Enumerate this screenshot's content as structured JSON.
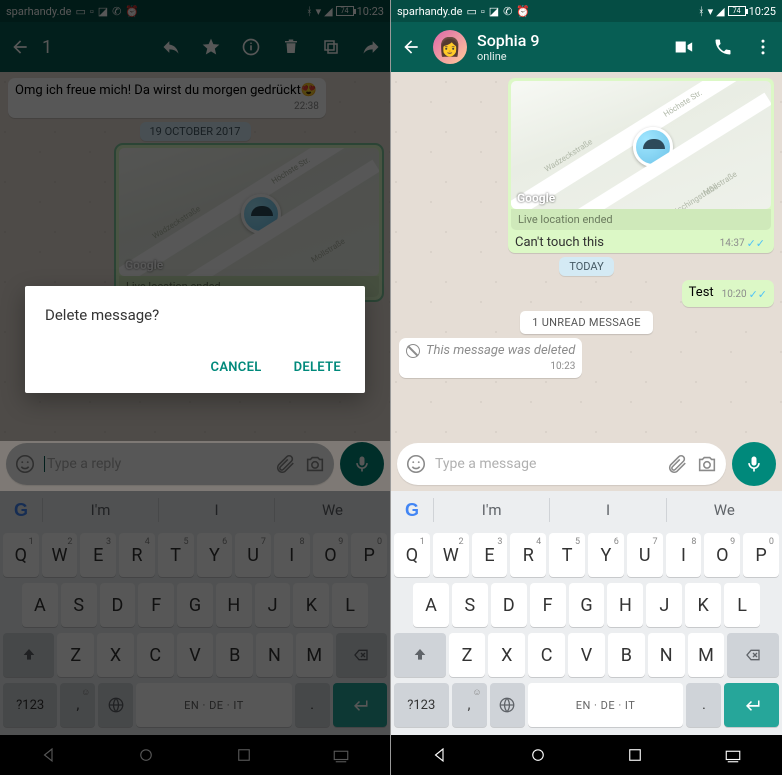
{
  "left": {
    "status": {
      "carrier": "sparhandy.de",
      "battery": "74",
      "time": "10:23"
    },
    "selection_count": "1",
    "date_chip": "19 OCTOBER 2017",
    "msg_in": {
      "text": "Omg ich freue mich! Da wirst du morgen gedrückt",
      "emoji": "😍",
      "time": "22:38"
    },
    "loc": {
      "footer": "Live location ended",
      "google": "Google"
    },
    "composer_placeholder": "Type a reply",
    "dialog": {
      "title": "Delete message?",
      "cancel": "CANCEL",
      "delete": "DELETE"
    }
  },
  "right": {
    "status": {
      "carrier": "sparhandy.de",
      "battery": "74",
      "time": "10:25"
    },
    "contact": {
      "name": "Sophia 9",
      "status": "online"
    },
    "loc": {
      "footer": "Live location ended",
      "caption": "Can't touch this",
      "time": "14:37",
      "google": "Google"
    },
    "today_chip": "TODAY",
    "test_msg": {
      "text": "Test",
      "time": "10:20"
    },
    "unread_chip": "1 UNREAD MESSAGE",
    "deleted": {
      "text": "This message was deleted",
      "time": "10:23"
    },
    "composer_placeholder": "Type a message"
  },
  "suggestions": [
    "I'm",
    "I",
    "We"
  ],
  "keyboard": {
    "row1": [
      [
        "Q",
        "1"
      ],
      [
        "W",
        "2"
      ],
      [
        "E",
        "3"
      ],
      [
        "R",
        "4"
      ],
      [
        "T",
        "5"
      ],
      [
        "Y",
        "6"
      ],
      [
        "U",
        "7"
      ],
      [
        "I",
        "8"
      ],
      [
        "O",
        "9"
      ],
      [
        "P",
        "0"
      ]
    ],
    "row2": [
      "A",
      "S",
      "D",
      "F",
      "G",
      "H",
      "J",
      "K",
      "L"
    ],
    "row3": [
      "Z",
      "X",
      "C",
      "V",
      "B",
      "N",
      "M"
    ],
    "sym": "?123",
    "space": "EN · DE · IT"
  }
}
